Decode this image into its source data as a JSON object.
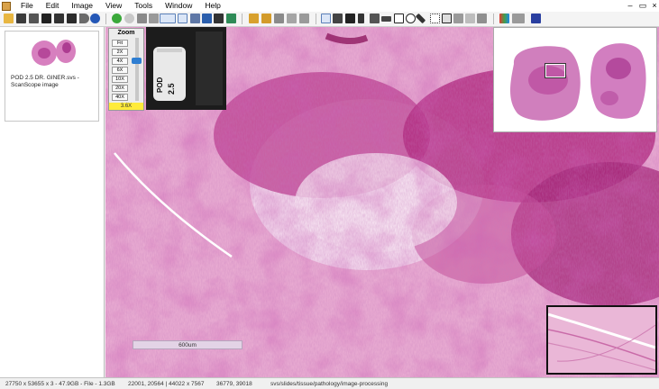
{
  "menubar": {
    "items": [
      {
        "label": "File"
      },
      {
        "label": "Edit"
      },
      {
        "label": "Image"
      },
      {
        "label": "View"
      },
      {
        "label": "Tools"
      },
      {
        "label": "Window"
      },
      {
        "label": "Help"
      }
    ],
    "window_controls": {
      "minimize": "–",
      "restore": "▭",
      "close": "×"
    }
  },
  "toolbar": {
    "icons": [
      "open-folder-icon",
      "save-icon",
      "print-icon",
      "camera-icon",
      "upload-icon",
      "page-icon",
      "info-icon",
      "go-forward-icon",
      "stop-icon",
      "network-icon",
      "layout-icon",
      "compare-view-icon",
      "layers-icon",
      "thumbnail-icon",
      "magnifier-icon",
      "export-icon",
      "edit-annotation-icon",
      "lock-icon",
      "transfer-icon",
      "refresh-icon",
      "hand-pan-icon",
      "select-region-icon",
      "snapshot-icon",
      "pen-icon",
      "freehand-icon",
      "ruler-icon",
      "rectangle-icon",
      "ellipse-icon",
      "arrow-icon",
      "grid-icon",
      "table-icon",
      "copy-icon",
      "paste-icon",
      "color-adjust-icon",
      "channels-icon",
      "help-icon"
    ]
  },
  "sidebar": {
    "thumbnail_caption": "POD 2.5 DR. GINER.svs - ScanScope image"
  },
  "viewer": {
    "zoom": {
      "title": "Zoom",
      "levels": [
        "Fit",
        "2X",
        "4X",
        "6X",
        "10X",
        "20X",
        "40X"
      ],
      "current": "3.6X"
    },
    "slide_label": {
      "line1": "POD",
      "line2": "2.5"
    },
    "scale_bar": "600um"
  },
  "colors": {
    "tissue_pink": "#e6a7cf",
    "stain_purple": "#b23587",
    "zoom_readout_bg": "#ffeb3b",
    "zoom_thumb": "#2f7ed2"
  },
  "status": {
    "dimensions": "27750 x 53655 x 3 - 47.9GB - File - 1.3GB",
    "coordinates": "22001, 20564 | 44022 x 7567",
    "position": "36779, 39018",
    "path": "svs/slides/tissue/pathology/image-processing"
  }
}
